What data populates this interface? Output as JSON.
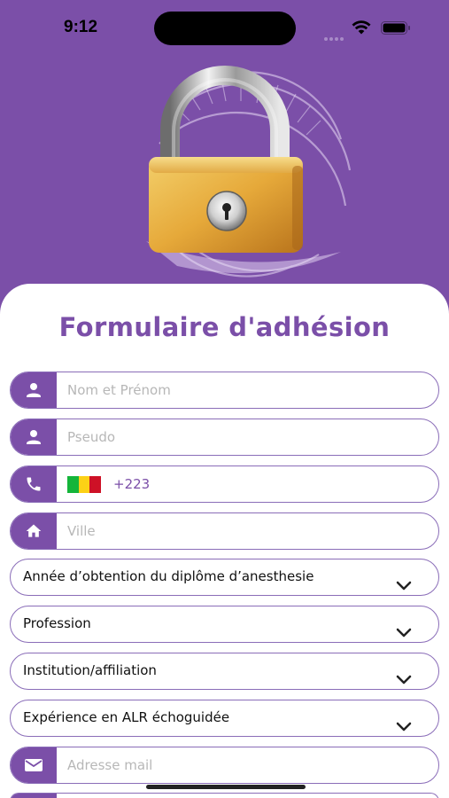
{
  "status_bar": {
    "time": "9:12"
  },
  "form": {
    "title": "Formulaire d'adhésion",
    "fields": {
      "name": {
        "placeholder": "Nom et Prénom",
        "icon": "person-icon"
      },
      "pseudo": {
        "placeholder": "Pseudo",
        "icon": "person-icon"
      },
      "phone": {
        "country_code": "+223",
        "icon": "phone-icon",
        "flag": "Mali"
      },
      "city": {
        "placeholder": "Ville",
        "icon": "home-icon"
      },
      "email": {
        "placeholder": "Adresse mail",
        "icon": "mail-icon"
      }
    },
    "selects": {
      "diploma_year": "Année d’obtention du diplôme d’anesthesie",
      "profession": "Profession",
      "institution": "Institution/affiliation",
      "experience": "Expérience en ALR échoguidée"
    }
  },
  "colors": {
    "primary": "#7b4fa8",
    "border": "#8a6db8",
    "flag_green": "#14b53a",
    "flag_yellow": "#fcd116",
    "flag_red": "#ce1126"
  }
}
